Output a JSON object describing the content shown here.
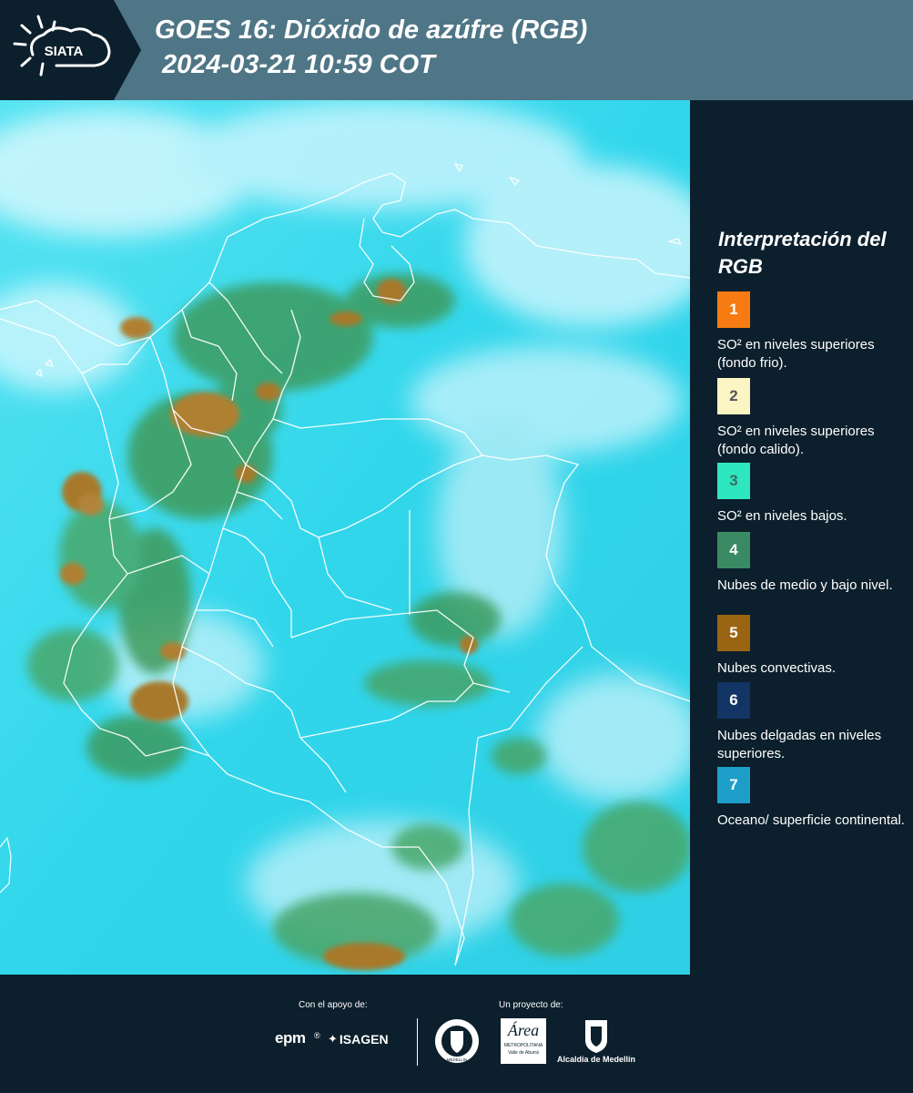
{
  "header": {
    "logo_text": "SIATA",
    "title_line1": "GOES 16: Dióxido de azúfre (RGB)",
    "title_line2": "2024-03-21 10:59 COT"
  },
  "legend": {
    "title": "Interpretación del RGB",
    "items": [
      {
        "number": "1",
        "label": "SO² en niveles superiores (fondo frio).",
        "color": "#f57b12",
        "num_color": "#ffffff"
      },
      {
        "number": "2",
        "label": "SO² en niveles superiores (fondo calido).",
        "color": "#fbf4c3",
        "num_color": "#555555"
      },
      {
        "number": "3",
        "label": "SO² en niveles bajos.",
        "color": "#2ee6c0",
        "num_color": "#3b6e62"
      },
      {
        "number": "4",
        "label": "Nubes de medio y bajo nivel.",
        "color": "#3a8b63",
        "num_color": "#ffffff"
      },
      {
        "number": "5",
        "label": "Nubes convectivas.",
        "color": "#9b6412",
        "num_color": "#ffffff"
      },
      {
        "number": "6",
        "label": "Nubes delgadas en niveles superiores.",
        "color": "#123566",
        "num_color": "#ffffff"
      },
      {
        "number": "7",
        "label": "Oceano/ superficie continental.",
        "color": "#1d9fc9",
        "num_color": "#ffffff"
      }
    ]
  },
  "footer": {
    "support_label": "Con el apoyo de:",
    "project_label": "Un proyecto de:",
    "brand_epm": "epm",
    "brand_isagen": "ISAGEN",
    "brand_area_line1": "Área",
    "brand_area_line2": "METROPOLITANA",
    "brand_area_line3": "Valle de Aburrá",
    "brand_alcaldia": "Alcaldía de Medellín",
    "brand_medellin": "MEDELLÍN"
  },
  "colors": {
    "header_bg": "#4f7686",
    "panel_bg": "#0c1f2c",
    "ocean": "#38d9ec",
    "cloud_white": "#e8fbff",
    "convective": "#9b6412",
    "low_cloud": "#3a8b63"
  }
}
